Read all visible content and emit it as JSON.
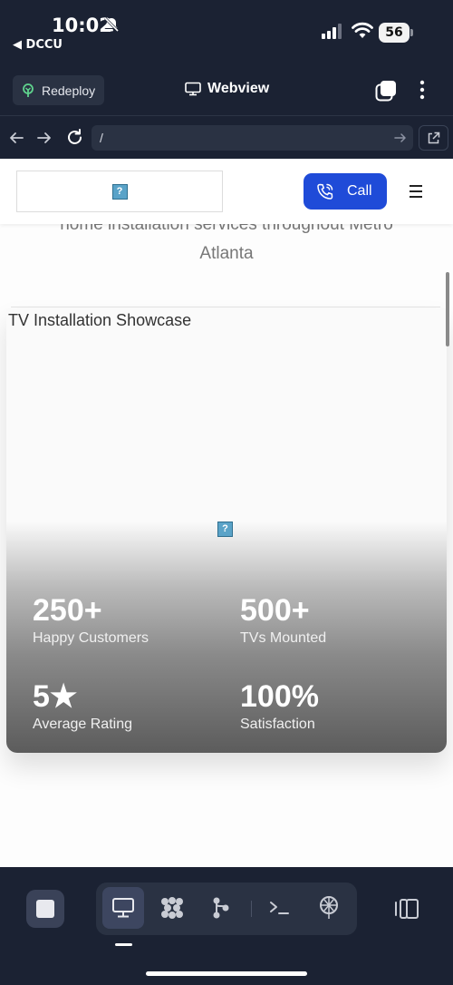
{
  "status_bar": {
    "time": "10:02",
    "back_app": "◀ DCCU",
    "battery": "56"
  },
  "toolbar": {
    "redeploy_label": "Redeploy",
    "title": "Webview"
  },
  "url_bar": {
    "value": "/"
  },
  "site": {
    "call_label": "Call",
    "tagline_line1": "home installation services throughout Metro",
    "tagline_line2": "Atlanta",
    "broken_image_glyph": "?",
    "showcase_title": "TV Installation Showcase",
    "stats": [
      {
        "value": "250+",
        "label": "Happy Customers"
      },
      {
        "value": "500+",
        "label": "TVs Mounted"
      },
      {
        "value": "5★",
        "label": "Average Rating"
      },
      {
        "value": "100%",
        "label": "Satisfaction"
      }
    ]
  },
  "colors": {
    "chrome_bg": "#1b2233",
    "call_button": "#1f4bd8"
  },
  "icons": {
    "redeploy": "sprout-icon",
    "webview": "monitor-icon",
    "dock": [
      "stop-icon",
      "monitor-icon",
      "grid-dots-icon",
      "branch-icon",
      "terminal-icon",
      "deploy-icon",
      "panel-toggle-icon"
    ]
  }
}
